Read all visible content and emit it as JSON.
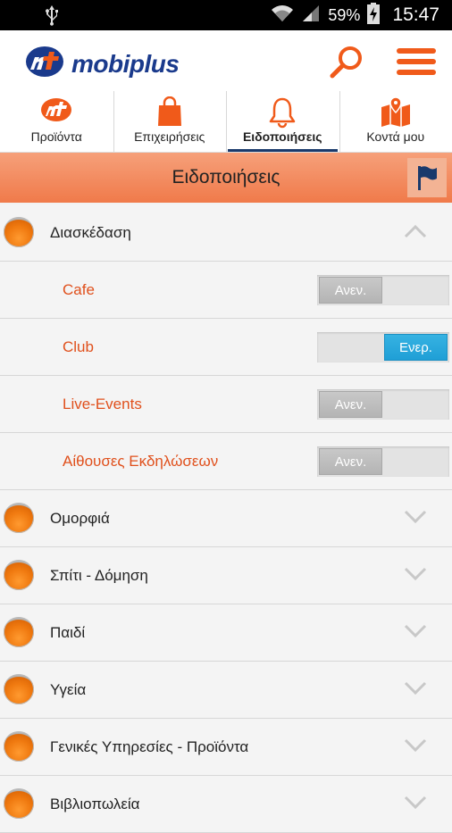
{
  "status_bar": {
    "battery_percent": "59%",
    "time": "15:47"
  },
  "header": {
    "logo_text": "mobiplus",
    "brand_color": "#1a3a8c",
    "accent_color": "#f05a1a"
  },
  "tabs": [
    {
      "label": "Προϊόντα",
      "icon": "mobiplus-logo-icon",
      "active": false
    },
    {
      "label": "Επιχειρήσεις",
      "icon": "shopping-bag-icon",
      "active": false
    },
    {
      "label": "Ειδοποιήσεις",
      "icon": "bell-icon",
      "active": true
    },
    {
      "label": "Κοντά μου",
      "icon": "map-pin-icon",
      "active": false
    }
  ],
  "section": {
    "title": "Ειδοποιήσεις"
  },
  "toggle_labels": {
    "off": "Ανεν.",
    "on": "Ενερ."
  },
  "categories": [
    {
      "label": "Διασκέδαση",
      "expanded": true,
      "subcategories": [
        {
          "label": "Cafe",
          "enabled": false
        },
        {
          "label": "Club",
          "enabled": true
        },
        {
          "label": "Live-Events",
          "enabled": false
        },
        {
          "label": "Αίθουσες Εκδηλώσεων",
          "enabled": false
        }
      ]
    },
    {
      "label": "Ομορφιά",
      "expanded": false
    },
    {
      "label": "Σπίτι - Δόμηση",
      "expanded": false
    },
    {
      "label": "Παιδί",
      "expanded": false
    },
    {
      "label": "Υγεία",
      "expanded": false
    },
    {
      "label": "Γενικές Υπηρεσίες - Προϊόντα",
      "expanded": false
    },
    {
      "label": "Βιβλιοπωλεία",
      "expanded": false
    }
  ]
}
